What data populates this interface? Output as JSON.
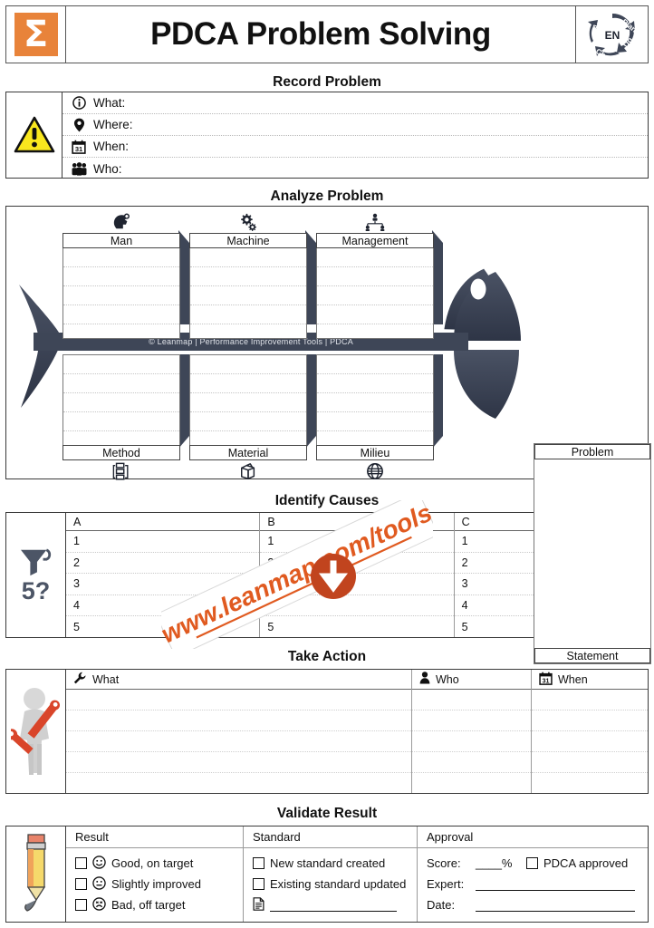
{
  "header": {
    "logo_glyph": "Σ",
    "logo_name": "leanmap-sigma-logo",
    "title": "PDCA Problem Solving",
    "pdca_center": "EN",
    "pdca_labels": [
      "Plan",
      "Do",
      "Check",
      "Act"
    ],
    "brand_color": "#e8833a"
  },
  "sections": {
    "record": "Record Problem",
    "analyze": "Analyze Problem",
    "causes": "Identify Causes",
    "action": "Take Action",
    "validate": "Validate Result"
  },
  "record_problem": {
    "icon": "warning-triangle-icon",
    "rows": [
      {
        "icon": "info-circle-icon",
        "label": "What:",
        "value": ""
      },
      {
        "icon": "location-pin-icon",
        "label": "Where:",
        "value": ""
      },
      {
        "icon": "calendar-31-icon",
        "label": "When:",
        "value": ""
      },
      {
        "icon": "people-group-icon",
        "label": "Who:",
        "value": ""
      }
    ]
  },
  "fishbone": {
    "spine_text": "© Leanmap | Performance Improvement Tools | PDCA",
    "top_categories": [
      {
        "label": "Man",
        "icon": "head-idea-icon"
      },
      {
        "label": "Machine",
        "icon": "gears-icon"
      },
      {
        "label": "Management",
        "icon": "org-chart-icon"
      }
    ],
    "bottom_categories": [
      {
        "label": "Method",
        "icon": "process-flow-icon"
      },
      {
        "label": "Material",
        "icon": "open-box-icon"
      },
      {
        "label": "Milieu",
        "icon": "globe-icon"
      }
    ],
    "problem_head": "Problem",
    "problem_foot": "Statement",
    "fish_color": "#3e4657"
  },
  "identify_causes": {
    "icon": "funnel-icon",
    "icon_label": "5?",
    "columns": [
      {
        "header": "A",
        "rows": [
          "1",
          "2",
          "3",
          "4",
          "5"
        ]
      },
      {
        "header": "B",
        "rows": [
          "1",
          "2",
          "3",
          "4",
          "5"
        ]
      },
      {
        "header": "C",
        "rows": [
          "1",
          "2",
          "3",
          "4",
          "5"
        ]
      }
    ]
  },
  "watermark": {
    "url": "www.leanmap.com/tools",
    "badge_icon": "down-arrow-icon",
    "badge_color": "#c1441e",
    "text_color": "#e05a20"
  },
  "take_action": {
    "icon": "person-with-wrench-icon",
    "columns": [
      {
        "header": "What",
        "icon": "wrench-icon"
      },
      {
        "header": "Who",
        "icon": "person-icon"
      },
      {
        "header": "When",
        "icon": "calendar-31-icon"
      }
    ],
    "row_count": 5
  },
  "validate_result": {
    "icon": "pencil-icon",
    "result": {
      "header": "Result",
      "options": [
        {
          "label": "Good, on target",
          "face": "smiley-happy-icon",
          "checked": false
        },
        {
          "label": "Slightly improved",
          "face": "smiley-neutral-icon",
          "checked": false
        },
        {
          "label": "Bad, off target",
          "face": "smiley-sad-icon",
          "checked": false
        }
      ]
    },
    "standard": {
      "header": "Standard",
      "options": [
        {
          "label": "New standard created",
          "checked": false
        },
        {
          "label": "Existing standard updated",
          "checked": false
        }
      ],
      "document_icon": "document-icon",
      "document_line": ""
    },
    "approval": {
      "header": "Approval",
      "score_label": "Score:",
      "score_value": "____%",
      "approved_label": "PDCA approved",
      "approved_checked": false,
      "expert_label": "Expert:",
      "expert_value": "",
      "date_label": "Date:",
      "date_value": ""
    }
  }
}
